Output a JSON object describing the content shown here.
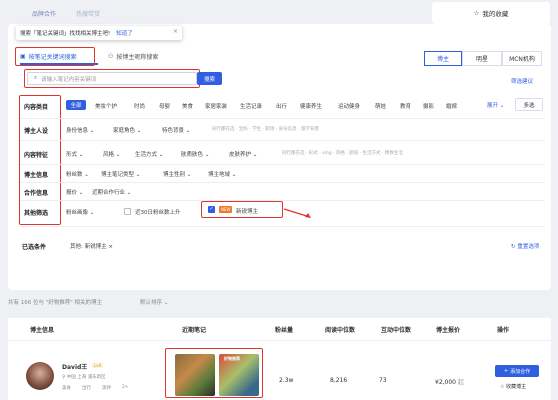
{
  "topbar": {
    "tabs": [
      "品牌合作",
      "热搜带货"
    ],
    "favorites": "我的收藏"
  },
  "tooltip": {
    "text": "搜索「笔记关键词」找找相关博主吧!",
    "know": "知道了",
    "close": "×"
  },
  "modes": {
    "keyword": "按笔记关键词搜索",
    "nickname": "按博主昵称搜索"
  },
  "search": {
    "placeholder": "请输入笔记内容关键词",
    "button": "搜索"
  },
  "segments": [
    "博主",
    "明星",
    "MCN机构"
  ],
  "filter_suggestion": "筛选建议",
  "rows": {
    "content": {
      "label": "内容类目",
      "all": "全部",
      "options": [
        "美妆个护",
        "时尚",
        "母婴",
        "美食",
        "家居家装",
        "生活记录",
        "出行",
        "健康养生",
        "运动健身",
        "萌娃",
        "教育",
        "摄影",
        "婚嫁"
      ],
      "expand": "展开",
      "multi": "多选"
    },
    "persona": {
      "label": "博主人设",
      "options": [
        "身份信息",
        "家庭角色",
        "特色背景"
      ],
      "hint": "同行都在选 · 宝妈 · 学生 · 职场 · 身份信息 · 留学背景"
    },
    "feature": {
      "label": "内容特征",
      "options": [
        "形式",
        "风格",
        "生活方式",
        "肤质肤色",
        "皮肤养护"
      ],
      "hint": "同行都在选 · 形式 · vlog · 风格 · 颜值 · 生活方式 · 精致生活"
    },
    "info": {
      "label": "博主信息",
      "options": [
        "粉丝数",
        "博主笔记类型",
        "博主性别",
        "博主地域"
      ]
    },
    "coop": {
      "label": "合作信息",
      "options": [
        "报价",
        "近期合作行业"
      ]
    },
    "other": {
      "label": "其他筛选",
      "options": [
        "粉丝画像",
        "近30日粉丝数上升"
      ],
      "new_badge": "NEW",
      "new_blogger": "新锐博主"
    }
  },
  "selected": {
    "label": "已选条件",
    "tag": "其他: 新锐博主",
    "reset": "重置选项"
  },
  "result_summary": "共有 166 位与 \"好物推荐\" 相关的博主",
  "sort": "默认排序",
  "table": {
    "headers": [
      "博主信息",
      "近期笔记",
      "粉丝量",
      "阅读中位数",
      "互动中位数",
      "博主报价",
      "操作"
    ],
    "row": {
      "name": "David王",
      "level": "Lv4",
      "location": "中国 上海 浦东新区",
      "tags": [
        "美食",
        "出行",
        "测评",
        "2+"
      ],
      "fans": "2.3w",
      "reads": "8,216",
      "interact": "73",
      "price": "¥2,000",
      "price_suffix": "起",
      "add": "添加合作",
      "collect": "收藏博主",
      "note_title": "好物推荐"
    }
  }
}
